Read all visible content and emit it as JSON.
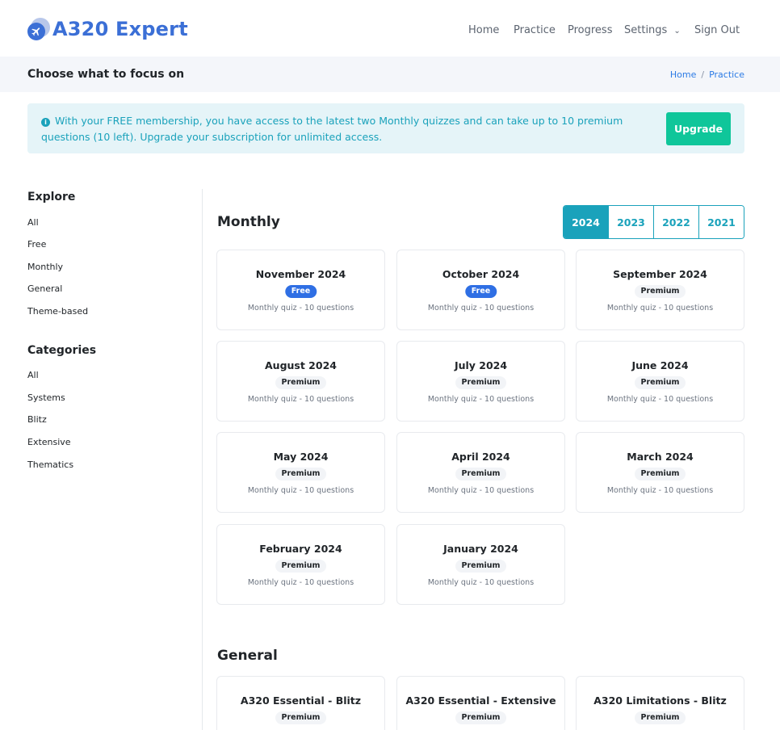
{
  "brand": {
    "name": "A320 Expert",
    "color": "#3b6fd6"
  },
  "nav": {
    "items": [
      {
        "label": "Home"
      },
      {
        "label": "Practice"
      },
      {
        "label": "Progress"
      },
      {
        "label": "Settings"
      },
      {
        "label": "Sign Out"
      }
    ],
    "settings_icon": "chevron-down-icon"
  },
  "page": {
    "title": "Choose what to focus on"
  },
  "breadcrumb": {
    "home": "Home",
    "separator": "/",
    "current": "Practice"
  },
  "alert": {
    "icon": "info-icon",
    "text": "With your FREE membership, you have access to the latest two Monthly quizzes and can take up to 10 premium questions (10 left). Upgrade your subscription for unlimited access.",
    "button": "Upgrade",
    "button_color": "#0fc69a",
    "background": "#e5f4f8"
  },
  "sidebar": {
    "explore": {
      "heading": "Explore",
      "items": [
        "All",
        "Free",
        "Monthly",
        "General",
        "Theme-based"
      ]
    },
    "categories": {
      "heading": "Categories",
      "items": [
        "All",
        "Systems",
        "Blitz",
        "Extensive",
        "Thematics"
      ]
    }
  },
  "monthly": {
    "title": "Monthly",
    "years": [
      "2024",
      "2023",
      "2022",
      "2021"
    ],
    "active_year": "2024",
    "accent": "#1aa2bb",
    "cards": [
      {
        "title": "November 2024",
        "badge": "Free",
        "sub": "Monthly quiz - 10 questions"
      },
      {
        "title": "October 2024",
        "badge": "Free",
        "sub": "Monthly quiz - 10 questions"
      },
      {
        "title": "September 2024",
        "badge": "Premium",
        "sub": "Monthly quiz - 10 questions"
      },
      {
        "title": "August 2024",
        "badge": "Premium",
        "sub": "Monthly quiz - 10 questions"
      },
      {
        "title": "July 2024",
        "badge": "Premium",
        "sub": "Monthly quiz - 10 questions"
      },
      {
        "title": "June 2024",
        "badge": "Premium",
        "sub": "Monthly quiz - 10 questions"
      },
      {
        "title": "May 2024",
        "badge": "Premium",
        "sub": "Monthly quiz - 10 questions"
      },
      {
        "title": "April 2024",
        "badge": "Premium",
        "sub": "Monthly quiz - 10 questions"
      },
      {
        "title": "March 2024",
        "badge": "Premium",
        "sub": "Monthly quiz - 10 questions"
      },
      {
        "title": "February 2024",
        "badge": "Premium",
        "sub": "Monthly quiz - 10 questions"
      },
      {
        "title": "January 2024",
        "badge": "Premium",
        "sub": "Monthly quiz - 10 questions"
      }
    ]
  },
  "general": {
    "title": "General",
    "cards": [
      {
        "title": "A320 Essential - Blitz",
        "badge": "Premium"
      },
      {
        "title": "A320 Essential - Extensive",
        "badge": "Premium"
      },
      {
        "title": "A320 Limitations - Blitz",
        "badge": "Premium"
      }
    ]
  }
}
